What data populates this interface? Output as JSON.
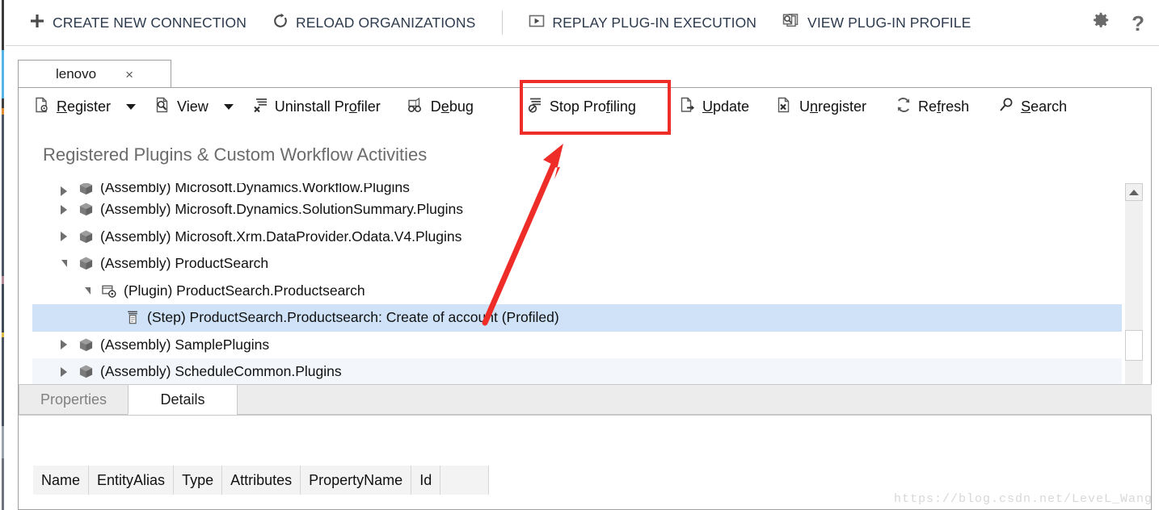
{
  "command_bar": {
    "items": [
      {
        "label": "CREATE NEW CONNECTION",
        "icon": "plus-icon"
      },
      {
        "label": "RELOAD ORGANIZATIONS",
        "icon": "refresh-circle-icon"
      },
      {
        "label": "REPLAY PLUG-IN EXECUTION",
        "icon": "play-box-icon"
      },
      {
        "label": "VIEW PLUG-IN PROFILE",
        "icon": "profile-search-icon"
      }
    ],
    "settings_icon": "gear-icon",
    "help_icon": "question-mark-icon"
  },
  "tab_strip": {
    "tabs": [
      {
        "label": "lenovo",
        "close": "×"
      }
    ]
  },
  "toolbar": {
    "buttons": [
      {
        "label": "Register",
        "pre": "",
        "key": "R",
        "post": "egister",
        "icon": "register-icon",
        "dropdown": true
      },
      {
        "label": "View",
        "pre": "Vie",
        "key": "",
        "post": "w",
        "icon": "view-icon",
        "dropdown": true
      },
      {
        "label": "Uninstall Profiler",
        "pre": "Uninstall Pr",
        "key": "o",
        "post": "filer",
        "icon": "uninstall-icon",
        "dropdown": false
      },
      {
        "label": "Debug",
        "pre": "D",
        "key": "e",
        "post": "bug",
        "icon": "debug-icon",
        "dropdown": false
      },
      {
        "label": "Stop Profiling",
        "pre": "Stop Pro",
        "key": "f",
        "post": "iling",
        "icon": "stop-profiling-icon",
        "dropdown": false
      },
      {
        "label": "Update",
        "pre": "",
        "key": "U",
        "post": "pdate",
        "icon": "update-icon",
        "dropdown": false
      },
      {
        "label": "Unregister",
        "pre": "U",
        "key": "n",
        "post": "register",
        "icon": "unregister-icon",
        "dropdown": false
      },
      {
        "label": "Refresh",
        "pre": "Re",
        "key": "f",
        "post": "resh",
        "icon": "refresh-icon",
        "dropdown": false
      },
      {
        "label": "Search",
        "pre": "",
        "key": "S",
        "post": "earch",
        "icon": "search-icon",
        "dropdown": false
      }
    ]
  },
  "content": {
    "heading": "Registered Plugins & Custom Workflow Activities",
    "tree_rows": [
      {
        "text": "(Assembly) Microsoft.Dynamics.Workflow.Plugins",
        "indent": 0,
        "expander": "right",
        "icon": "assembly-icon",
        "state": "clip-top",
        "stripe": "plain"
      },
      {
        "text": "(Assembly) Microsoft.Dynamics.SolutionSummary.Plugins",
        "indent": 0,
        "expander": "right",
        "icon": "assembly-icon",
        "state": "normal",
        "stripe": "plain"
      },
      {
        "text": "(Assembly) Microsoft.Xrm.DataProvider.Odata.V4.Plugins",
        "indent": 0,
        "expander": "right",
        "icon": "assembly-icon",
        "state": "normal",
        "stripe": "plain"
      },
      {
        "text": "(Assembly) ProductSearch",
        "indent": 0,
        "expander": "down",
        "icon": "assembly-icon",
        "state": "normal",
        "stripe": "plain"
      },
      {
        "text": "(Plugin) ProductSearch.Productsearch",
        "indent": 1,
        "expander": "down",
        "icon": "plugin-icon",
        "state": "normal",
        "stripe": "plain"
      },
      {
        "text": "(Step) ProductSearch.Productsearch: Create of account (Profiled)",
        "indent": 2,
        "expander": "none",
        "icon": "step-icon",
        "state": "normal",
        "stripe": "selected"
      },
      {
        "text": "(Assembly) SamplePlugins",
        "indent": 0,
        "expander": "right",
        "icon": "assembly-icon",
        "state": "normal",
        "stripe": "plain"
      },
      {
        "text": "(Assembly) ScheduleCommon.Plugins",
        "indent": 0,
        "expander": "right",
        "icon": "assembly-icon",
        "state": "normal",
        "stripe": "alt"
      },
      {
        "text": "(Assembly) ScheduleCommon.Plugins",
        "indent": 0,
        "expander": "right",
        "icon": "assembly-icon",
        "state": "clip-bottom",
        "stripe": "plain"
      }
    ],
    "scrollbar": {
      "up_arrow": "▲",
      "down_arrow": "▼"
    }
  },
  "bottom_panel": {
    "tabs": [
      {
        "label": "Properties",
        "active": false
      },
      {
        "label": "Details",
        "active": true
      }
    ],
    "grid_columns": [
      "Name",
      "EntityAlias",
      "Type",
      "Attributes",
      "PropertyName",
      "Id"
    ],
    "grid_rows": []
  },
  "annotations": {
    "highlight_color": "#ef2d28",
    "highlighted_button": "Stop Profiling"
  },
  "watermark": {
    "text": "https://blog.csdn.net/LeveL_Wang"
  }
}
